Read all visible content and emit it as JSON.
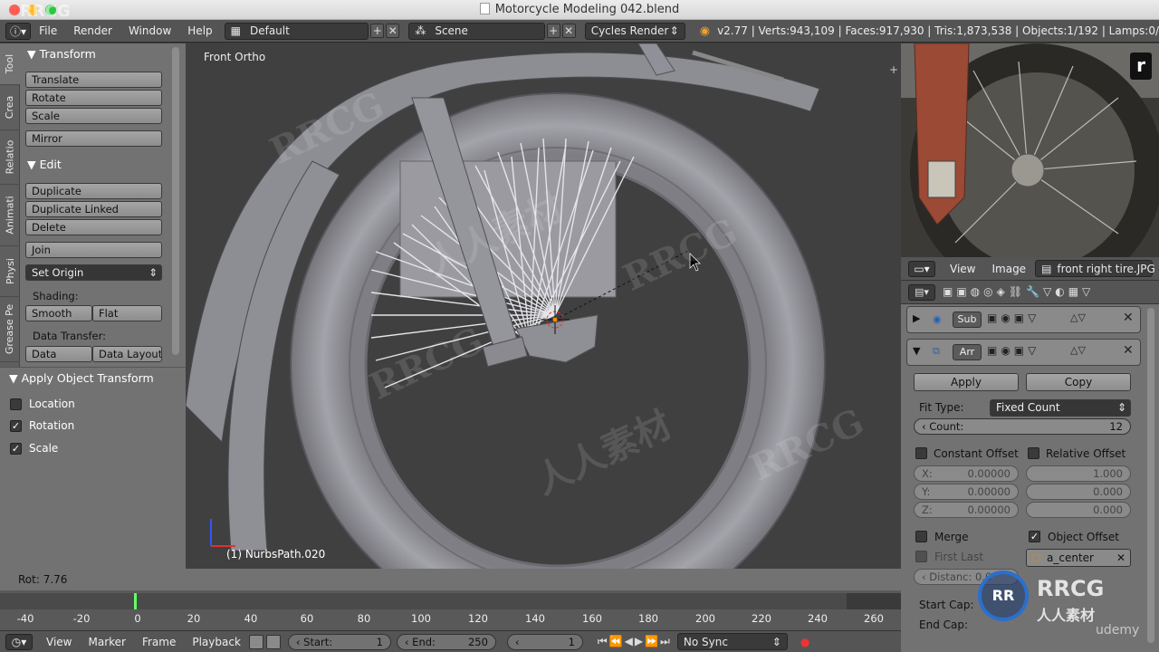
{
  "window": {
    "title": "Motorcycle Modeling 042.blend",
    "watermark_top_left": "RRCG"
  },
  "info_header": {
    "menus": [
      "File",
      "Render",
      "Window",
      "Help"
    ],
    "layout": "Default",
    "scene": "Scene",
    "engine": "Cycles Render",
    "stats": "v2.77 | Verts:943,109 | Faces:917,930 | Tris:1,873,538 | Objects:1/192 | Lamps:0/"
  },
  "tool_shelf": {
    "tabs": [
      "Tool",
      "Crea",
      "Relatio",
      "Animati",
      "Physi",
      "Grease Pe"
    ],
    "transform": {
      "title": "Transform",
      "buttons": [
        "Translate",
        "Rotate",
        "Scale"
      ],
      "mirror": "Mirror"
    },
    "edit": {
      "title": "Edit",
      "buttons": [
        "Duplicate",
        "Duplicate Linked",
        "Delete"
      ],
      "join": "Join",
      "set_origin": "Set Origin",
      "shading_label": "Shading:",
      "smooth": "Smooth",
      "flat": "Flat",
      "data_transfer_label": "Data Transfer:",
      "data": "Data",
      "data_layout": "Data Layout"
    }
  },
  "apply_panel": {
    "title": "Apply Object Transform",
    "options": [
      {
        "label": "Location",
        "checked": false
      },
      {
        "label": "Rotation",
        "checked": true
      },
      {
        "label": "Scale",
        "checked": true
      }
    ]
  },
  "viewport": {
    "view_label": "Front Ortho",
    "object_label": "(1) NurbsPath.020"
  },
  "status": {
    "text": "Rot: 7.76"
  },
  "timeline": {
    "ticks": [
      "-40",
      "-20",
      "0",
      "20",
      "40",
      "60",
      "80",
      "100",
      "120",
      "140",
      "160",
      "180",
      "200",
      "220",
      "240",
      "260"
    ],
    "current_frame": 0
  },
  "bottom_bar": {
    "menus": [
      "View",
      "Marker",
      "Frame",
      "Playback"
    ],
    "start_label": "Start:",
    "start_value": "1",
    "end_label": "End:",
    "end_value": "250",
    "current": "1",
    "sync": "No Sync"
  },
  "image_editor": {
    "menus": [
      "View",
      "Image"
    ],
    "image_name": "front right tire.JPG"
  },
  "properties": {
    "modifier_sub": "Sub",
    "modifier_arr": "Arr",
    "apply": "Apply",
    "copy": "Copy",
    "fit_type_label": "Fit Type:",
    "fit_type": "Fixed Count",
    "count_label": "Count:",
    "count_value": "12",
    "constant_offset": "Constant Offset",
    "relative_offset": "Relative Offset",
    "const": [
      {
        "axis": "X:",
        "value": "0.00000"
      },
      {
        "axis": "Y:",
        "value": "0.00000"
      },
      {
        "axis": "Z:",
        "value": "0.00000"
      }
    ],
    "rel": [
      "1.000",
      "0.000",
      "0.000"
    ],
    "merge": "Merge",
    "object_offset": "Object Offset",
    "first_last": "First Last",
    "offset_object": "a_center",
    "distance": "Distanc: 0.0",
    "start_cap": "Start Cap:",
    "end_cap": "End Cap:"
  },
  "watermark": {
    "brand": "RRCG",
    "brand_cn": "人人素材",
    "author": "udemy"
  }
}
